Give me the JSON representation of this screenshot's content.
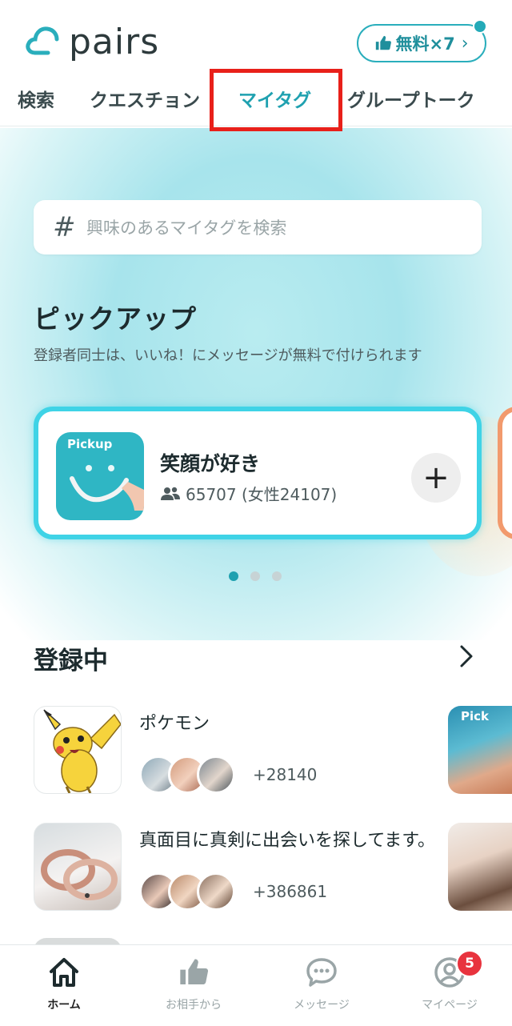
{
  "header": {
    "logo_text": "pairs",
    "free_button": {
      "label": "無料×7",
      "icon": "thumbs-up-icon"
    }
  },
  "tabs": [
    {
      "label": "検索"
    },
    {
      "label": "クエスチョン"
    },
    {
      "label": "マイタグ",
      "active": true
    },
    {
      "label": "グループトーク"
    }
  ],
  "search": {
    "placeholder": "興味のあるマイタグを検索",
    "icon": "hash-icon"
  },
  "pickup": {
    "title": "ピックアップ",
    "subtitle": "登録者同士は、いいね！にメッセージが無料で付けられます",
    "card": {
      "badge": "Pickup",
      "name": "笑顔が好き",
      "count": "65707 (女性24107)"
    },
    "pager": {
      "count": 3,
      "active": 0
    }
  },
  "registered": {
    "title": "登録中",
    "items": [
      {
        "name": "ポケモン",
        "count": "+28140"
      },
      {
        "name": "真面目に真剣に出会いを探してます。",
        "count": "+386861"
      }
    ]
  },
  "side_badge": "Pick",
  "tabbar": [
    {
      "label": "ホーム",
      "icon": "home-icon",
      "active": true
    },
    {
      "label": "お相手から",
      "icon": "thumbs-up-icon"
    },
    {
      "label": "メッセージ",
      "icon": "chat-bubble-icon"
    },
    {
      "label": "マイページ",
      "icon": "user-icon",
      "badge": "5"
    }
  ],
  "colors": {
    "accent": "#1fa1b0",
    "highlight_box": "#e8201a",
    "badge": "#e8333e"
  }
}
